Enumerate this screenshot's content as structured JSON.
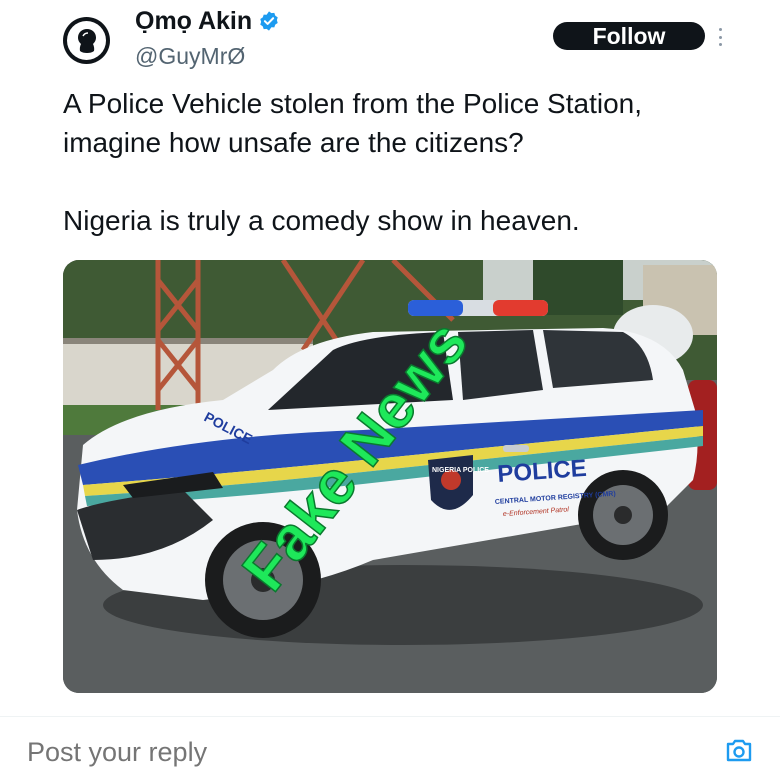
{
  "tweet": {
    "author_name": "Ọmọ Akin",
    "handle": "@GuyMrØ",
    "follow_label": "Follow",
    "text_lines": [
      "A Police Vehicle stolen from the Police Station,",
      "imagine how unsafe are the citizens?",
      "Nigeria is truly a comedy show in heaven."
    ]
  },
  "media": {
    "door_text": "POLICE",
    "sub_text": "CENTRAL MOTOR REGISTRY (CMR)",
    "patrol_text": "e-Enforcement Patrol",
    "hood_text": "POLICE",
    "badge_text": "NIGERIA POLICE",
    "overlay_text": "Fake News",
    "overlay_color": "#1ee85a"
  },
  "reply": {
    "placeholder": "Post your reply"
  },
  "colors": {
    "verified": "#1d9bf0",
    "camera": "#1d9bf0"
  }
}
